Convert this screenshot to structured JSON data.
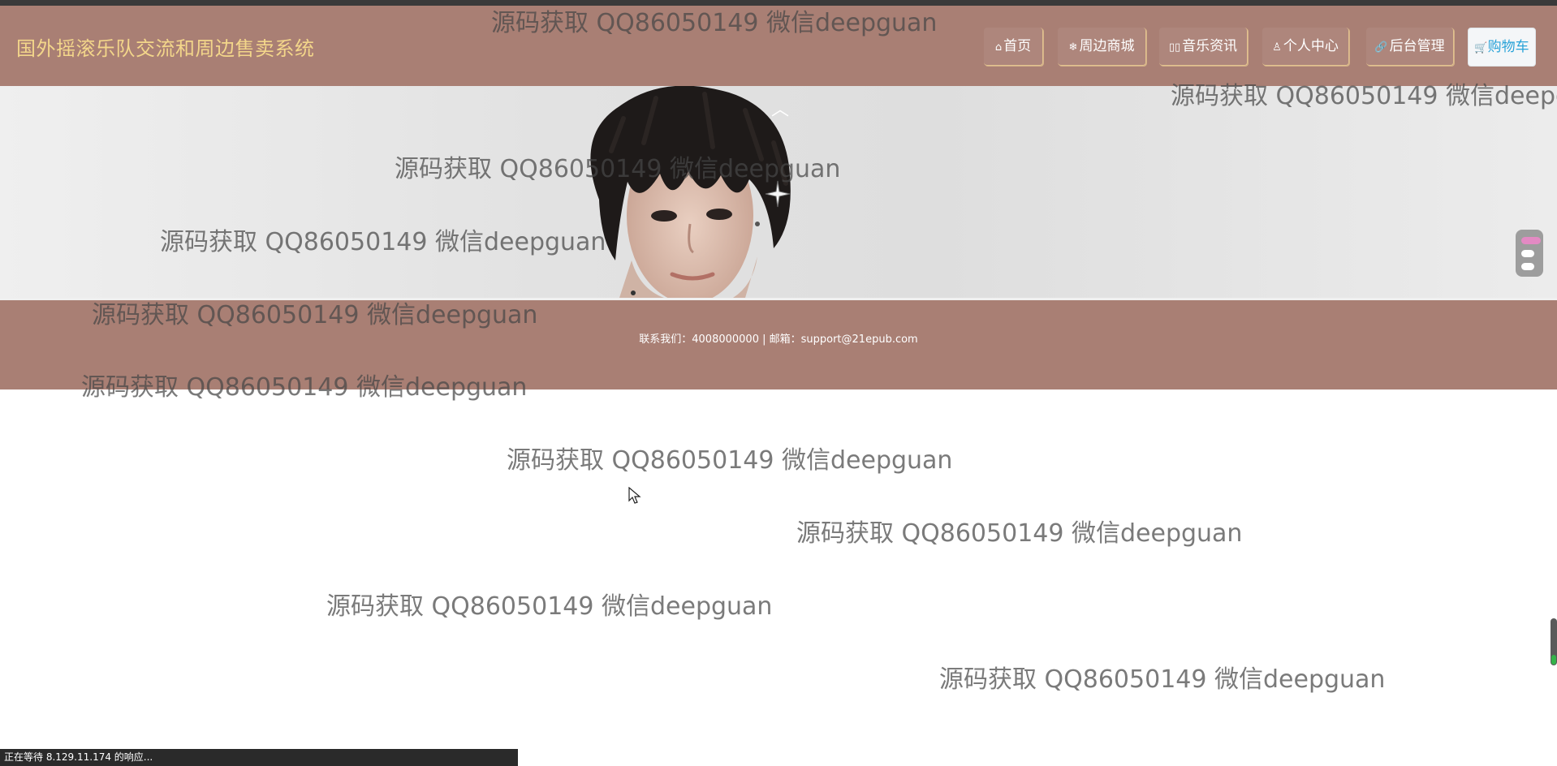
{
  "header": {
    "site_title": "国外摇滚乐队交流和周边售卖系统",
    "nav": [
      {
        "icon": "⌂",
        "label": "首页"
      },
      {
        "icon": "❄",
        "label": "周边商城"
      },
      {
        "icon": "▯▯",
        "label": "音乐资讯"
      },
      {
        "icon": "♙",
        "label": "个人中心"
      },
      {
        "icon": "🔗",
        "label": "后台管理"
      }
    ],
    "cart": {
      "icon": "🛒",
      "label": "购物车"
    }
  },
  "banner": {
    "slides": 3,
    "active_slide": 1
  },
  "footer": {
    "contact_text": "联系我们：4008000000 | 邮箱：support@21epub.com"
  },
  "watermark": {
    "text": "源码获取 QQ86050149 微信deepguan"
  },
  "status_bar": {
    "text": "正在等待 8.129.11.174 的响应..."
  },
  "colors": {
    "header_bg": "#a97f74",
    "title_color": "#f3d68a",
    "cart_text": "#2aa3d8",
    "active_dot": "#e38ac3"
  }
}
